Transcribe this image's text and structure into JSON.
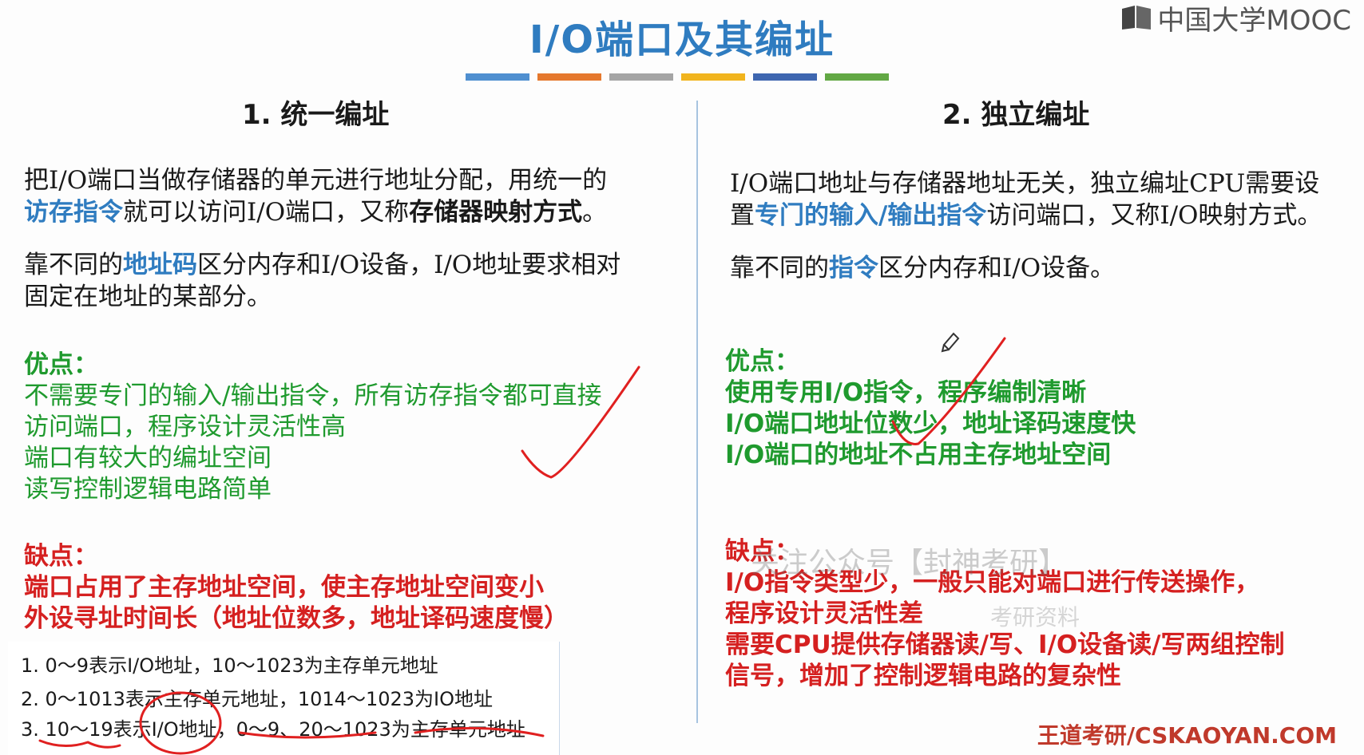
{
  "title": "I/O端口及其编址",
  "logo_text": "中国大学MOOC",
  "color_bar": [
    "#4f8fd0",
    "#e5782d",
    "#a5a5a5",
    "#f1b41d",
    "#3e66b0",
    "#62a844"
  ],
  "left": {
    "heading": "1. 统一编址",
    "p1": {
      "a": "把I/O端口当做存储器的单元进行地址分配，用统一的",
      "b_blue": "访存指令",
      "c": "就可以访问I/O端口，又称",
      "d_bold": "存储器映射方式",
      "e": "。"
    },
    "p2": {
      "a": "靠不同的",
      "b_blue": "地址码",
      "c": "区分内存和I/O设备，I/O地址要求相对",
      "d": "固定在地址的某部分。"
    },
    "pros_label": "优点：",
    "pros": [
      "不需要专门的输入/输出指令，所有访存指令都可直接",
      "访问端口，程序设计灵活性高",
      "端口有较大的编址空间",
      "读写控制逻辑电路简单"
    ],
    "cons_label": "缺点：",
    "cons": [
      "端口占用了主存地址空间，使主存地址空间变小",
      "外设寻址时间长（地址位数多，地址译码速度慢）"
    ]
  },
  "right": {
    "heading": "2. 独立编址",
    "p1": {
      "a": "I/O端口地址与存储器地址无关，独立编址CPU需要设",
      "b": "置",
      "c_blue": "专门的输入/输出指令",
      "d": "访问端口，又称I/O映射方式。"
    },
    "p2": {
      "a": "靠不同的",
      "b_blue": "指令",
      "c": "区分内存和I/O设备。"
    },
    "pros_label": "优点：",
    "pros": [
      "使用专用I/O指令，程序编制清晰",
      "I/O端口地址位数少，地址译码速度快",
      "I/O端口的地址不占用主存地址空间"
    ],
    "cons_label": "缺点：",
    "cons": [
      "I/O指令类型少，一般只能对端口进行传送操作，",
      "程序设计灵活性差",
      "需要CPU提供存储器读/写、I/O设备读/写两组控制",
      "信号，增加了控制逻辑电路的复杂性"
    ]
  },
  "notes": [
    "1. 0～9表示I/O地址，10～1023为主存单元地址",
    "2. 0～1013表示主存单元地址，1014～1023为IO地址",
    "3. 10～19表示I/O地址，0～9、20～1023为主存单元地址"
  ],
  "watermark": "关注公众号【封神考研】",
  "watermark2": "考研资料",
  "footer": "王道考研/CSKAOYAN.COM",
  "annotation_color": "#e02020"
}
